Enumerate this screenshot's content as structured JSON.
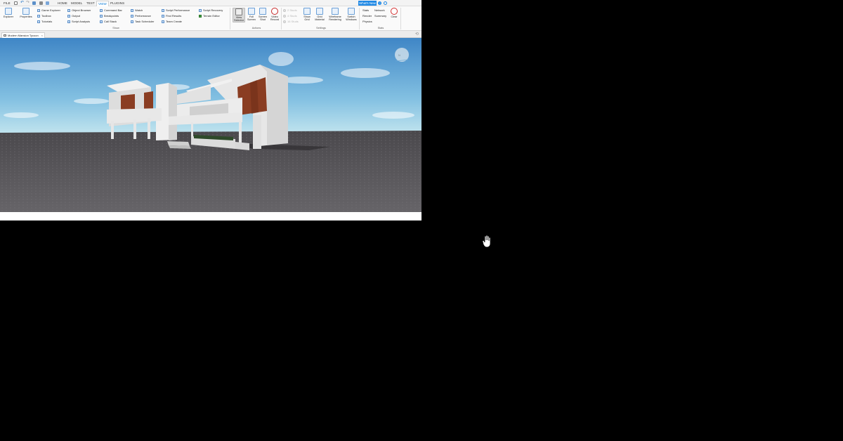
{
  "menubar": {
    "file_label": "FILE",
    "tabs": [
      {
        "label": "HOME",
        "active": false
      },
      {
        "label": "MODEL",
        "active": false
      },
      {
        "label": "TEST",
        "active": false
      },
      {
        "label": "VIEW",
        "active": true
      },
      {
        "label": "PLUGINS",
        "active": false
      }
    ],
    "whats_new_label": "What's New"
  },
  "ribbon": {
    "show_group": {
      "label": "Show",
      "explorer": "Explorer",
      "properties": "Properties",
      "col1": [
        "Game Explorer",
        "Toolbox",
        "Tutorials"
      ],
      "col2": [
        "Object Browser",
        "Output",
        "Script Analysis"
      ],
      "col3": [
        "Command Bar",
        "Breakpoints",
        "Call Stack"
      ],
      "col4": [
        "Watch",
        "Performance",
        "Task Scheduler"
      ],
      "col5": [
        "Script Performance",
        "Find Results",
        "Team Create"
      ],
      "col6": [
        "Script Recovery",
        "Terrain Editor"
      ]
    },
    "actions_group": {
      "label": "Actions",
      "buttons": [
        {
          "line1": "View",
          "line2": "Selector",
          "selected": true
        },
        {
          "line1": "Full",
          "line2": "Screen",
          "selected": false
        },
        {
          "line1": "Screen",
          "line2": "Shot",
          "selected": false
        },
        {
          "line1": "Video",
          "line2": "Record",
          "selected": false
        }
      ]
    },
    "settings_group": {
      "label": "Settings",
      "disabled_items": [
        "2 Studs",
        "4 Studs",
        "16 Studs"
      ],
      "buttons": [
        {
          "line1": "Show",
          "line2": "Grid"
        },
        {
          "line1": "Grid",
          "line2": "Material"
        },
        {
          "line1": "Wireframe",
          "line2": "Rendering"
        },
        {
          "line1": "Switch",
          "line2": "Windows"
        }
      ]
    },
    "stats_group": {
      "label": "Stats",
      "col1": [
        "Stats",
        "Render",
        "Physics"
      ],
      "col2": [
        "Network",
        "Summary"
      ],
      "clear_label": "Clear"
    }
  },
  "document_tab": {
    "title": "Modern Mansion Tycoon",
    "close": "×"
  },
  "viewport": {
    "compass_label": "N"
  },
  "colors": {
    "accent": "#1e88e5",
    "sky_top": "#3f86c6",
    "sky_bottom": "#bfe3ee",
    "ground": "#5f5d60",
    "wood": "#8a3d22",
    "clear_red": "#d32f2f"
  }
}
